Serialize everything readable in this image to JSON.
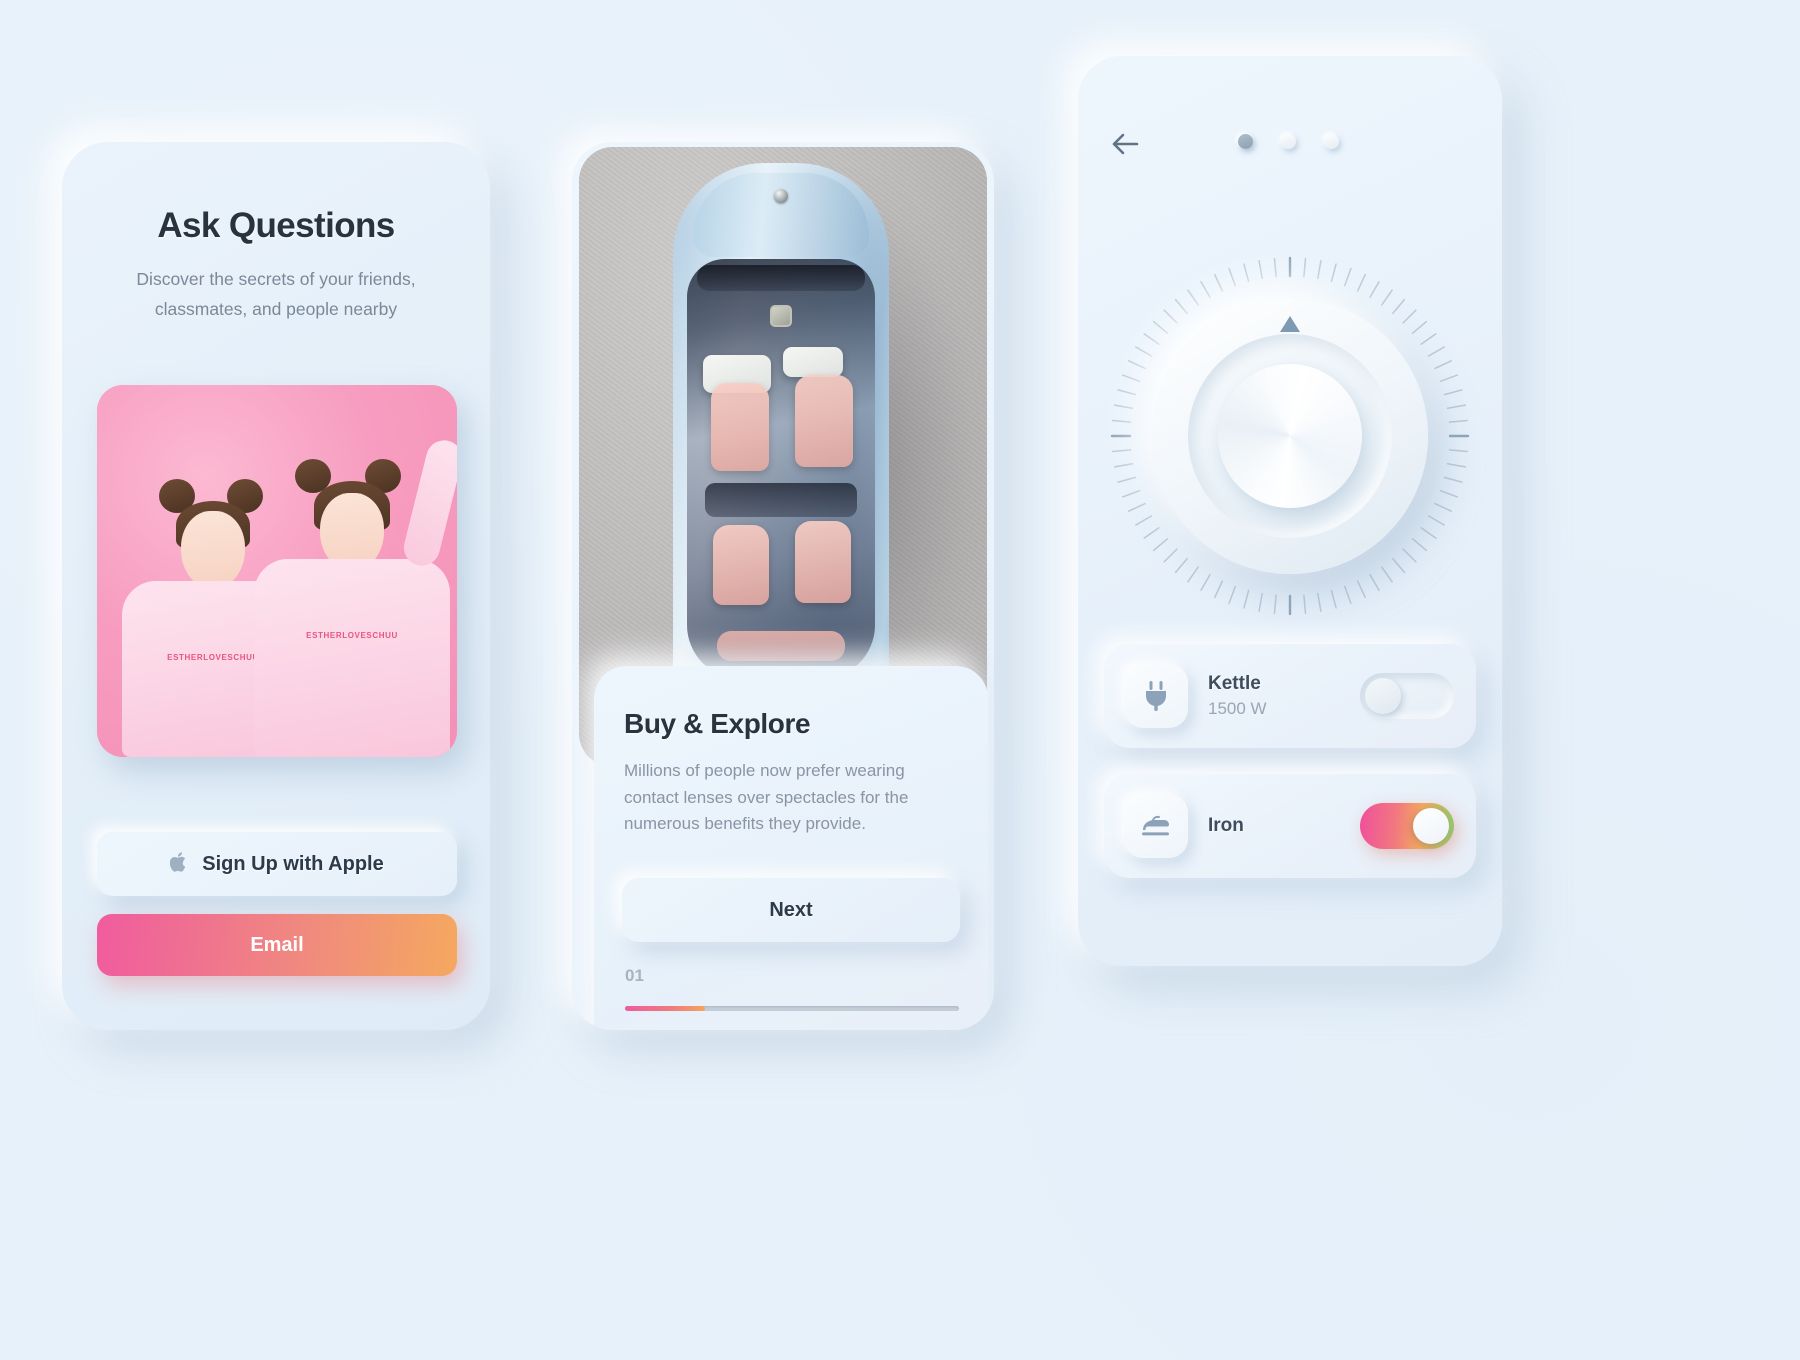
{
  "background_color": "#e7f1fa",
  "accent_gradient": [
    "#ef4f9c",
    "#f2787f",
    "#f4a45f",
    "#8fc96f"
  ],
  "card_one": {
    "name": "onboarding-card",
    "title": "Ask Questions",
    "subtitle": "Discover the secrets of your friends, classmates, and people nearby",
    "photo_alt": "Two women in pink ESTHERLOVESCHUU sweatshirts on pink background",
    "photo_logo_text": "ESTHERLOVESCHUU",
    "apple_button": {
      "label": "Sign Up with Apple",
      "icon": "apple-icon",
      "glyph": ""
    },
    "email_button": {
      "label": "Email"
    }
  },
  "card_two": {
    "name": "product-card",
    "photo_alt": "Top-down view of a light blue concept car on grey asphalt",
    "title": "Buy & Explore",
    "body": "Millions of people now prefer wearing contact lenses over spectacles for the numerous benefits they provide.",
    "next_button": {
      "label": "Next"
    },
    "step_label": "01",
    "progress_percent": 24
  },
  "card_three": {
    "name": "smart-home-card",
    "back_icon": "arrow-left-icon",
    "page_dots": [
      {
        "active": true
      },
      {
        "active": false
      },
      {
        "active": false
      }
    ],
    "knob": {
      "name": "rotary-dial",
      "pointer_icon": "triangle-up-icon",
      "tick_count": 72
    },
    "devices": [
      {
        "name": "Kettle",
        "power": "1500 W",
        "icon": "plug-icon",
        "toggle_state": "off"
      },
      {
        "name": "Iron",
        "power": "",
        "icon": "iron-icon",
        "toggle_state": "on"
      }
    ]
  }
}
